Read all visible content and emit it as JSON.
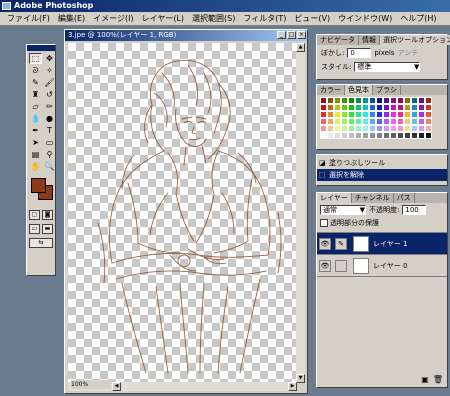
{
  "app": {
    "title": "Adobe Photoshop"
  },
  "menu": [
    "ファイル(F)",
    "編集(E)",
    "イメージ(I)",
    "レイヤー(L)",
    "選択範囲(S)",
    "フィルタ(T)",
    "ビュー(V)",
    "ウインドウ(W)",
    "ヘルプ(H)"
  ],
  "document": {
    "title": "3.jpe @ 100%(レイヤー 1, RGB)",
    "zoom": "100%"
  },
  "tools": [
    "marquee",
    "move",
    "lasso",
    "magic-wand",
    "airbrush",
    "brush",
    "stamp",
    "history-brush",
    "eraser",
    "pencil",
    "blur",
    "dodge",
    "pen",
    "type",
    "path-select",
    "shape",
    "notes",
    "eyedropper",
    "hand",
    "zoom"
  ],
  "colors": {
    "foreground": "#8b3a1a",
    "background": "#8b3a1a",
    "titlebar": "#0a246a",
    "panel": "#d4d0c8"
  },
  "nav_panel": {
    "tabs": [
      "ナビゲータ",
      "情報",
      "選択ツールオプション"
    ],
    "feather_label": "ぼかし:",
    "feather_value": "0",
    "feather_unit": "pixels",
    "antialias": "アンチ",
    "style_label": "スタイル:",
    "style_value": "標準"
  },
  "color_panel": {
    "tabs": [
      "カラー",
      "色見本",
      "ブラシ"
    ]
  },
  "history_panel": {
    "items": [
      {
        "label": "塗りつぶしツール",
        "selected": false
      },
      {
        "label": "選択を解除",
        "selected": true
      }
    ]
  },
  "layers_panel": {
    "tabs": [
      "レイヤー",
      "チャンネル",
      "パス"
    ],
    "blend_mode": "通常",
    "opacity_label": "不透明度:",
    "opacity_value": "100",
    "preserve_label": "透明部分の保護",
    "layers": [
      {
        "name": "レイヤー 1",
        "selected": true
      },
      {
        "name": "レイヤー 0",
        "selected": false
      }
    ]
  }
}
